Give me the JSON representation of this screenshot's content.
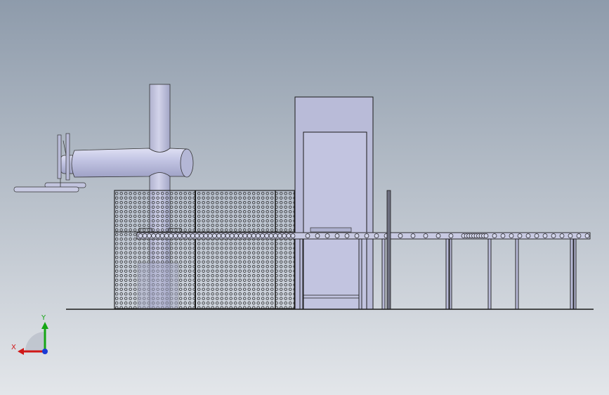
{
  "viewport": {
    "background_top": "#8e9bab",
    "background_bottom": "#e3e6ea",
    "line_color": "#1a1a1a",
    "part_fill": "#b9bbd8"
  },
  "triad": {
    "x_label": "X",
    "y_label": "Y",
    "x_color": "#d01818",
    "y_color": "#14a614",
    "z_color": "#1a3bd6"
  }
}
